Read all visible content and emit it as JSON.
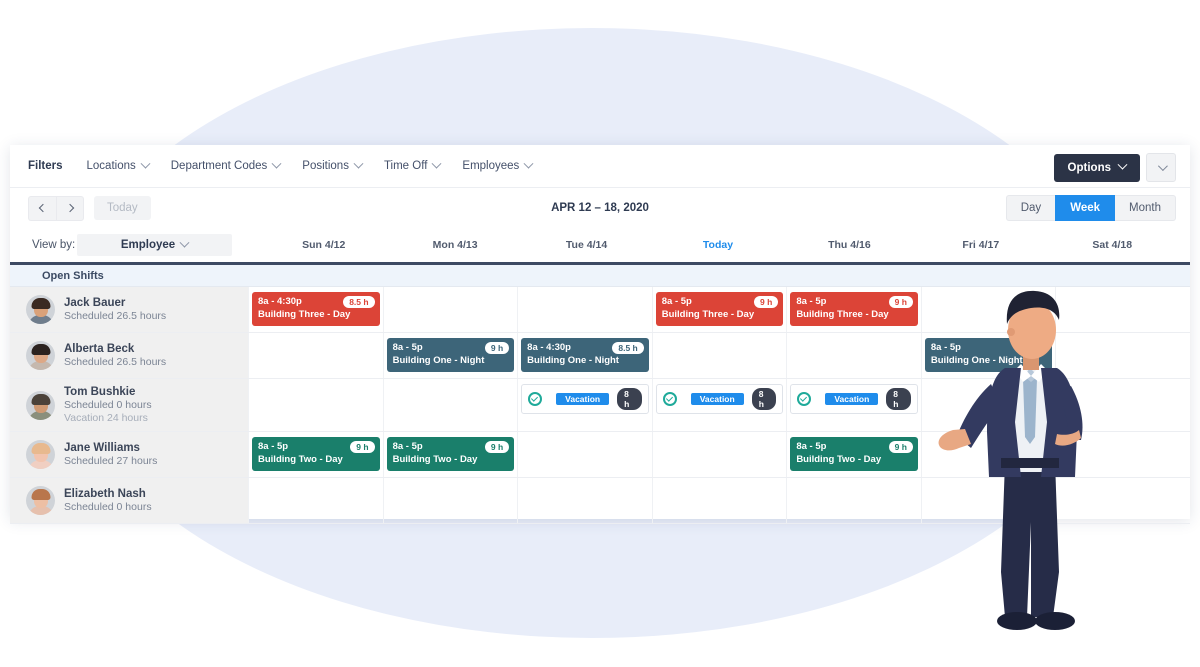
{
  "filters": {
    "label": "Filters",
    "items": [
      {
        "label": "Locations",
        "icon": "chevron-down-icon"
      },
      {
        "label": "Department Codes",
        "icon": "chevron-down-icon"
      },
      {
        "label": "Positions",
        "icon": "chevron-down-icon"
      },
      {
        "label": "Time Off",
        "icon": "chevron-down-icon"
      },
      {
        "label": "Employees",
        "icon": "chevron-down-icon"
      }
    ],
    "options_label": "Options",
    "options_caret_icon": "chevron-down-icon"
  },
  "datenav": {
    "prev_icon": "chevron-left-icon",
    "next_icon": "chevron-right-icon",
    "today_label": "Today",
    "date_range": "APR 12 – 18, 2020",
    "views": [
      {
        "label": "Day",
        "active": false
      },
      {
        "label": "Week",
        "active": true
      },
      {
        "label": "Month",
        "active": false
      }
    ]
  },
  "viewby": {
    "label": "View by:",
    "value": "Employee",
    "caret_icon": "chevron-down-icon"
  },
  "days": [
    {
      "label": "Sun 4/12",
      "today": false
    },
    {
      "label": "Mon 4/13",
      "today": false
    },
    {
      "label": "Tue 4/14",
      "today": false
    },
    {
      "label": "Today",
      "today": true
    },
    {
      "label": "Thu 4/16",
      "today": false
    },
    {
      "label": "Fri 4/17",
      "today": false
    },
    {
      "label": "Sat 4/18",
      "today": false
    }
  ],
  "open_shifts_label": "Open Shifts",
  "colors": {
    "accent_blue": "#1f8ceb",
    "shift_red": "#dc4437",
    "shift_slate": "#3d6579",
    "shift_green": "#1a7f6b",
    "options_dark": "#2b3346",
    "bg_ellipse": "#e8edf9",
    "timeoff_check": "#1faa9a"
  },
  "employees": [
    {
      "name": "Jack Bauer",
      "scheduled": "Scheduled 26.5 hours",
      "vacation": null,
      "avatar": {
        "skin": "#d9a179",
        "hair": "#3a2a22",
        "body": "#6f7d8c"
      },
      "shifts": [
        {
          "day": 0,
          "kind": "shift",
          "color": "red",
          "time": "8a - 4:30p",
          "location": "Building Three - Day",
          "hours": "8.5 h"
        },
        {
          "day": 1,
          "kind": "empty"
        },
        {
          "day": 2,
          "kind": "empty"
        },
        {
          "day": 3,
          "kind": "shift",
          "color": "red",
          "time": "8a - 5p",
          "location": "Building Three - Day",
          "hours": "9 h"
        },
        {
          "day": 4,
          "kind": "shift",
          "color": "red",
          "time": "8a - 5p",
          "location": "Building Three - Day",
          "hours": "9 h"
        },
        {
          "day": 5,
          "kind": "empty"
        },
        {
          "day": 6,
          "kind": "empty"
        }
      ]
    },
    {
      "name": "Alberta Beck",
      "scheduled": "Scheduled 26.5 hours",
      "vacation": null,
      "avatar": {
        "skin": "#dda886",
        "hair": "#2c2320",
        "body": "#c5b8ae"
      },
      "shifts": [
        {
          "day": 0,
          "kind": "empty"
        },
        {
          "day": 1,
          "kind": "shift",
          "color": "slate",
          "time": "8a - 5p",
          "location": "Building One - Night",
          "hours": "9 h"
        },
        {
          "day": 2,
          "kind": "shift",
          "color": "slate",
          "time": "8a - 4:30p",
          "location": "Building One - Night",
          "hours": "8.5 h"
        },
        {
          "day": 3,
          "kind": "empty"
        },
        {
          "day": 4,
          "kind": "empty"
        },
        {
          "day": 5,
          "kind": "shift",
          "color": "slate",
          "time": "8a - 5p",
          "location": "Building One - Night",
          "hours": ""
        },
        {
          "day": 6,
          "kind": "empty"
        }
      ]
    },
    {
      "name": "Tom Bushkie",
      "scheduled": "Scheduled 0 hours",
      "vacation": "Vacation 24 hours",
      "avatar": {
        "skin": "#cf9a73",
        "hair": "#4b4239",
        "body": "#8a8f7c"
      },
      "shifts": [
        {
          "day": 0,
          "kind": "empty"
        },
        {
          "day": 1,
          "kind": "empty"
        },
        {
          "day": 2,
          "kind": "timeoff",
          "badge": "Vacation",
          "hours": "8 h",
          "status_icon": "check-circle-icon"
        },
        {
          "day": 3,
          "kind": "timeoff",
          "badge": "Vacation",
          "hours": "8 h",
          "status_icon": "check-circle-icon"
        },
        {
          "day": 4,
          "kind": "timeoff",
          "badge": "Vacation",
          "hours": "8 h",
          "status_icon": "check-circle-icon"
        },
        {
          "day": 5,
          "kind": "empty"
        },
        {
          "day": 6,
          "kind": "empty"
        }
      ]
    },
    {
      "name": "Jane Williams",
      "scheduled": "Scheduled 27 hours",
      "vacation": null,
      "avatar": {
        "skin": "#f2c4ae",
        "hair": "#e8b98e",
        "body": "#f0cfc2"
      },
      "shifts": [
        {
          "day": 0,
          "kind": "shift",
          "color": "green",
          "time": "8a - 5p",
          "location": "Building Two - Day",
          "hours": "9 h"
        },
        {
          "day": 1,
          "kind": "shift",
          "color": "green",
          "time": "8a - 5p",
          "location": "Building Two - Day",
          "hours": "9 h"
        },
        {
          "day": 2,
          "kind": "empty"
        },
        {
          "day": 3,
          "kind": "empty"
        },
        {
          "day": 4,
          "kind": "shift",
          "color": "green",
          "time": "8a - 5p",
          "location": "Building Two - Day",
          "hours": "9 h"
        },
        {
          "day": 5,
          "kind": "empty"
        },
        {
          "day": 6,
          "kind": "empty"
        }
      ]
    },
    {
      "name": "Elizabeth Nash",
      "scheduled": "Scheduled 0 hours",
      "vacation": null,
      "avatar": {
        "skin": "#edbfa4",
        "hair": "#b9764c",
        "body": "#e6c0ad"
      },
      "shifts": [
        {
          "day": 0,
          "kind": "empty"
        },
        {
          "day": 1,
          "kind": "empty"
        },
        {
          "day": 2,
          "kind": "empty"
        },
        {
          "day": 3,
          "kind": "empty"
        },
        {
          "day": 4,
          "kind": "empty"
        },
        {
          "day": 5,
          "kind": "empty"
        },
        {
          "day": 6,
          "kind": "empty"
        }
      ]
    }
  ],
  "illustration": {
    "name": "businessman-pointing-illustration"
  }
}
